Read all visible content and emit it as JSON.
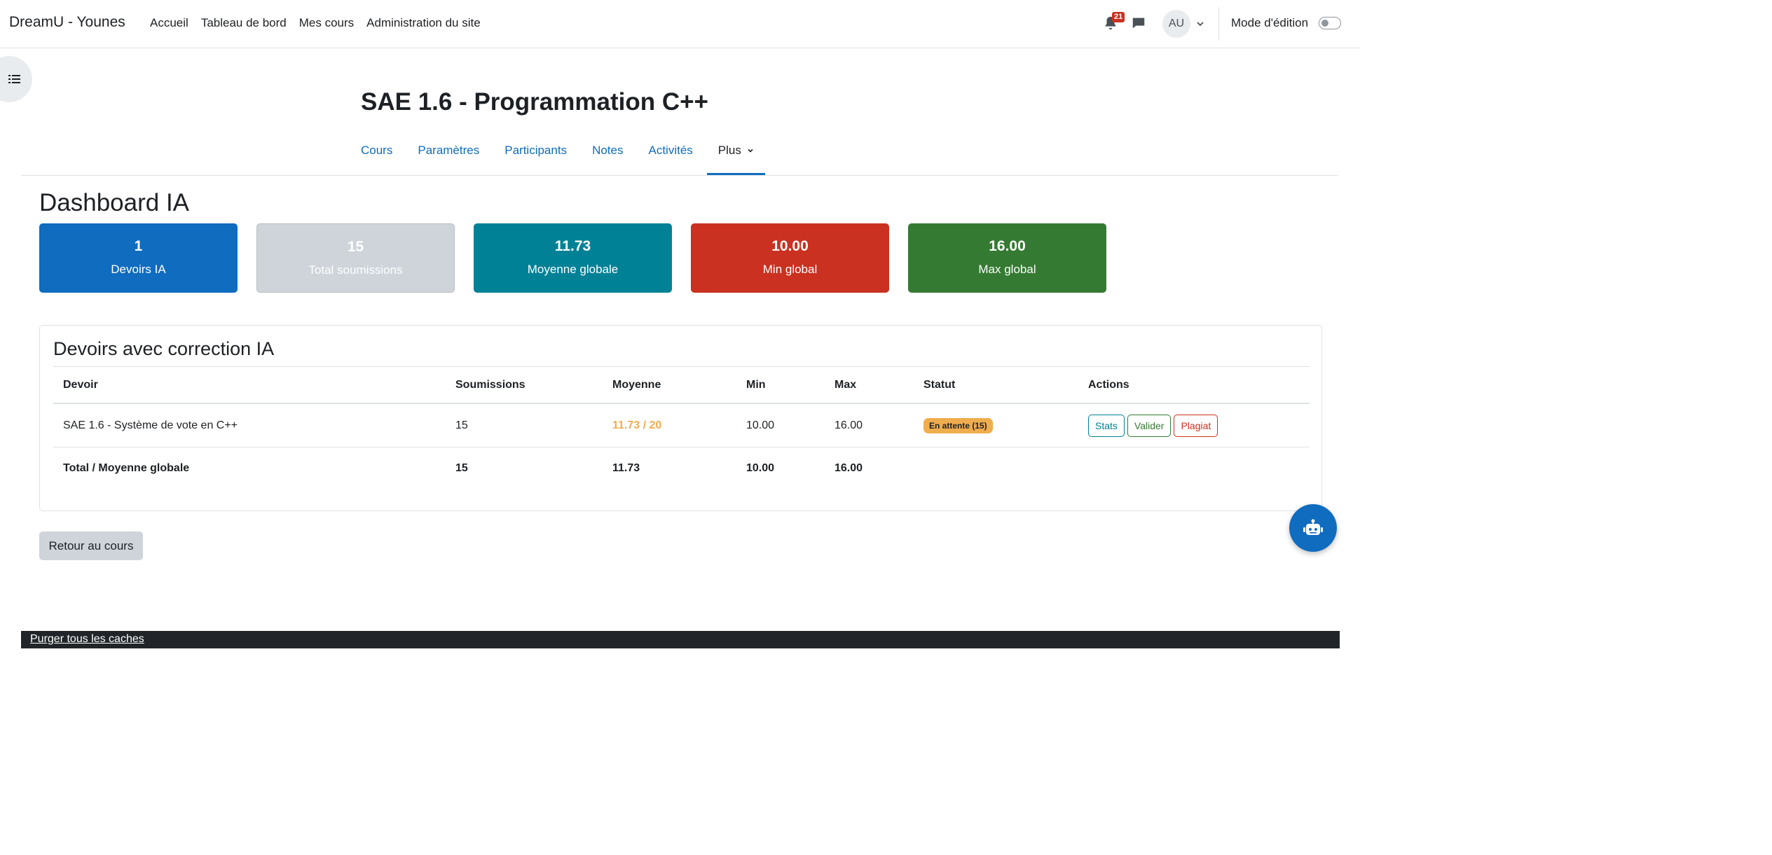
{
  "navbar": {
    "brand": "DreamU - Younes",
    "items": [
      "Accueil",
      "Tableau de bord",
      "Mes cours",
      "Administration du site"
    ],
    "notification_count": "21",
    "avatar_initials": "AU",
    "edit_mode_label": "Mode d'édition",
    "edit_mode_on": false
  },
  "course": {
    "title": "SAE 1.6 - Programmation C++",
    "tabs": [
      "Cours",
      "Paramètres",
      "Participants",
      "Notes",
      "Activités"
    ],
    "more_tab": "Plus",
    "active_tab": "Plus"
  },
  "dashboard": {
    "title": "Dashboard IA",
    "stats": [
      {
        "value": "1",
        "label": "Devoirs IA",
        "color": "#0f6cbf"
      },
      {
        "value": "15",
        "label": "Total soumissions",
        "color": "#ced4da"
      },
      {
        "value": "11.73",
        "label": "Moyenne globale",
        "color": "#008196"
      },
      {
        "value": "10.00",
        "label": "Min global",
        "color": "#ca3120"
      },
      {
        "value": "16.00",
        "label": "Max global",
        "color": "#357a32"
      }
    ]
  },
  "assignments": {
    "title": "Devoirs avec correction IA",
    "columns": [
      "Devoir",
      "Soumissions",
      "Moyenne",
      "Min",
      "Max",
      "Statut",
      "Actions"
    ],
    "rows": [
      {
        "devoir": "SAE 1.6 - Système de vote en C++",
        "soumissions": "15",
        "moyenne": "11.73 / 20",
        "min": "10.00",
        "max": "16.00",
        "statut": "En attente (15)",
        "actions": [
          "Stats",
          "Valider",
          "Plagiat"
        ]
      }
    ],
    "total": {
      "label": "Total / Moyenne globale",
      "soumissions": "15",
      "moyenne": "11.73",
      "min": "10.00",
      "max": "16.00"
    }
  },
  "back_button": "Retour au cours",
  "footer": {
    "purge_link": "Purger tous les caches"
  },
  "colors": {
    "primary": "#0f6cbf",
    "warning": "#f0ad4e",
    "danger": "#ca3120",
    "success": "#357a32",
    "info": "#008196"
  },
  "icons": {
    "drawer": "list-icon",
    "notifications": "bell-icon",
    "messages": "chat-icon",
    "fab": "ai-assistant-icon"
  }
}
